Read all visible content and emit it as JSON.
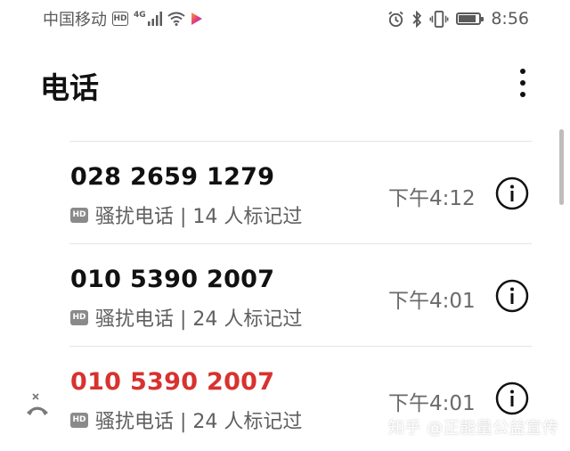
{
  "status_bar": {
    "carrier": "中国移动",
    "hd_label": "HD",
    "network_type": "4G",
    "time": "8:56",
    "battery_level": 0.85,
    "icons": [
      "signal-icon",
      "wifi-icon",
      "music-icon",
      "alarm-icon",
      "bluetooth-icon",
      "vibrate-icon",
      "battery-icon"
    ]
  },
  "header": {
    "title": "电话",
    "more_icon": "more-vertical-icon"
  },
  "calls": [
    {
      "number": "028 2659 1279",
      "hd": "HD",
      "label": "骚扰电话 | 14 人标记过",
      "time": "下午4:12",
      "missed": false
    },
    {
      "number": "010 5390 2007",
      "hd": "HD",
      "label": "骚扰电话 | 24 人标记过",
      "time": "下午4:01",
      "missed": false
    },
    {
      "number": "010 5390 2007",
      "hd": "HD",
      "label": "骚扰电话 | 24 人标记过",
      "time": "下午4:01",
      "missed": true
    }
  ],
  "colors": {
    "missed": "#d8322f",
    "text_primary": "#111111",
    "text_secondary": "#5f5f5f"
  },
  "watermark": "知乎 @正能量公益宣传"
}
